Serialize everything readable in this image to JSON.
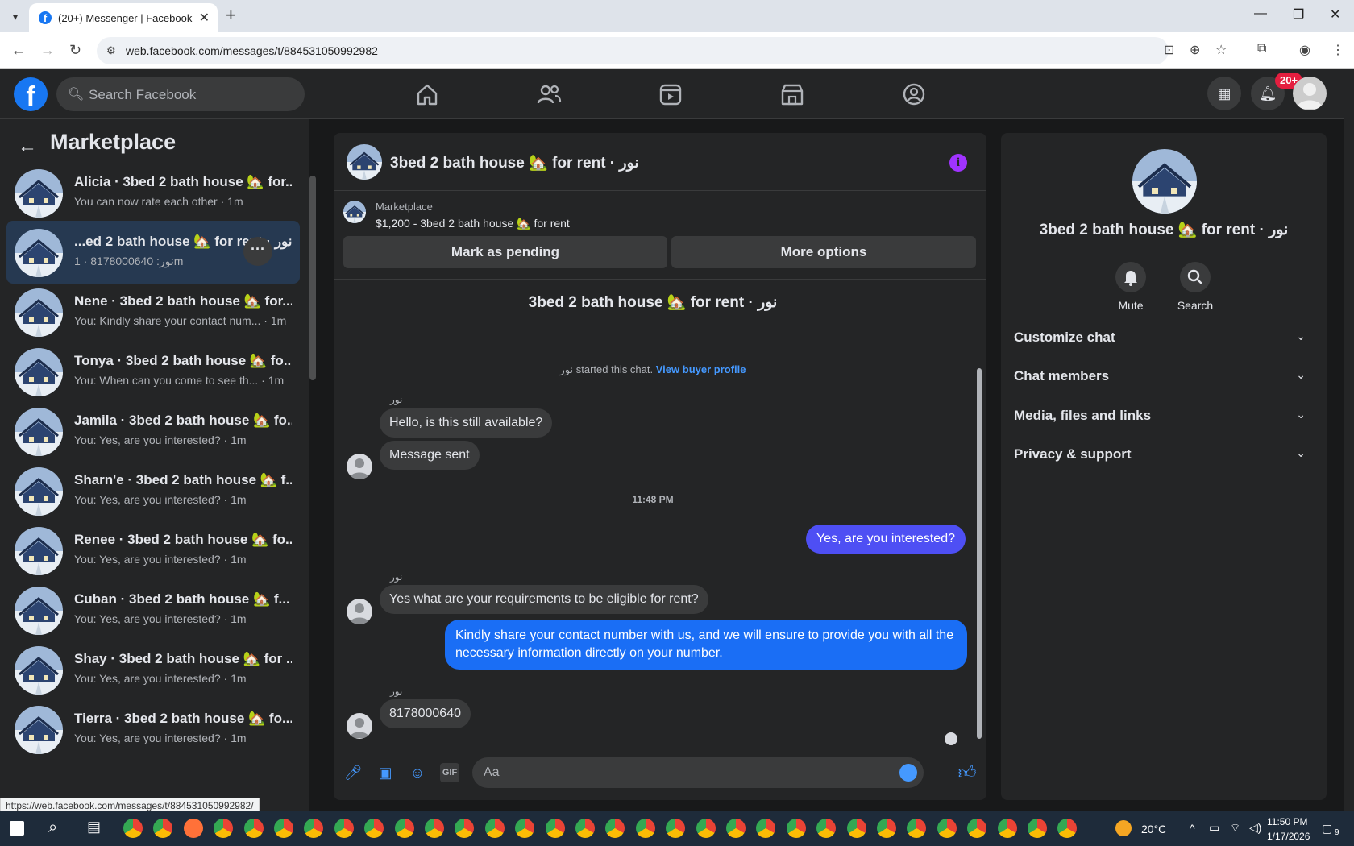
{
  "browser": {
    "tab_title": "(20+) Messenger | Facebook",
    "url": "web.facebook.com/messages/t/884531050992982",
    "status_url": "https://web.facebook.com/messages/t/884531050992982/"
  },
  "header": {
    "search_placeholder": "Search Facebook",
    "notif_badge": "20+"
  },
  "left": {
    "title": "Marketplace",
    "conversations": [
      {
        "name": "Alicia · 3bed 2 bath house 🏡 for...",
        "preview": "You can now rate each other · 1m"
      },
      {
        "name": "...ed 2 bath house 🏡 for rent · نور",
        "preview": "نور: 8178000640 · 1m"
      },
      {
        "name": "Nene · 3bed 2 bath house 🏡 for...",
        "preview": "You: Kindly share your contact num... · 1m"
      },
      {
        "name": "Tonya · 3bed 2 bath house 🏡 fo...",
        "preview": "You: When can you come to see th... · 1m"
      },
      {
        "name": "Jamila · 3bed 2 bath house 🏡 fo...",
        "preview": "You: Yes, are you interested? · 1m"
      },
      {
        "name": "Sharn'e · 3bed 2 bath house 🏡 f...",
        "preview": "You: Yes, are you interested? · 1m"
      },
      {
        "name": "Renee · 3bed 2 bath house 🏡 fo...",
        "preview": "You: Yes, are you interested? · 1m"
      },
      {
        "name": "Cuban · 3bed 2 bath house 🏡 f...",
        "preview": "You: Yes, are you interested? · 1m"
      },
      {
        "name": "Shay · 3bed 2 bath house 🏡 for ...",
        "preview": "You: Yes, are you interested? · 1m"
      },
      {
        "name": "Tierra · 3bed 2 bath house 🏡 fo...",
        "preview": "You: Yes, are you interested? · 1m"
      }
    ]
  },
  "chat": {
    "title": "3bed 2 bath house 🏡 for rent · نور",
    "marketplace_label": "Marketplace",
    "listing": "$1,200 - 3bed 2 bath house 🏡 for rent",
    "mark_pending": "Mark as pending",
    "more_options": "More options",
    "started_text": "نور started this chat.",
    "view_profile": "View buyer profile",
    "sender": "نور",
    "msg1": "Hello, is this still available?",
    "msg2": "Message sent",
    "time": "11:48 PM",
    "out1": "Yes, are you interested?",
    "msg3": "Yes what are your requirements to be eligible for rent?",
    "out2": "Kindly share your contact number with us, and we will ensure to provide you with all the necessary information directly on your number.",
    "msg4": "8178000640",
    "composer_placeholder": "Aa"
  },
  "right": {
    "title": "3bed 2 bath house 🏡 for rent · نور",
    "mute": "Mute",
    "search": "Search",
    "sections": [
      "Customize chat",
      "Chat members",
      "Media, files and links",
      "Privacy & support"
    ]
  },
  "taskbar": {
    "weather": "20°C",
    "time": "11:50 PM",
    "date": "1/17/2026",
    "notif": "9"
  }
}
